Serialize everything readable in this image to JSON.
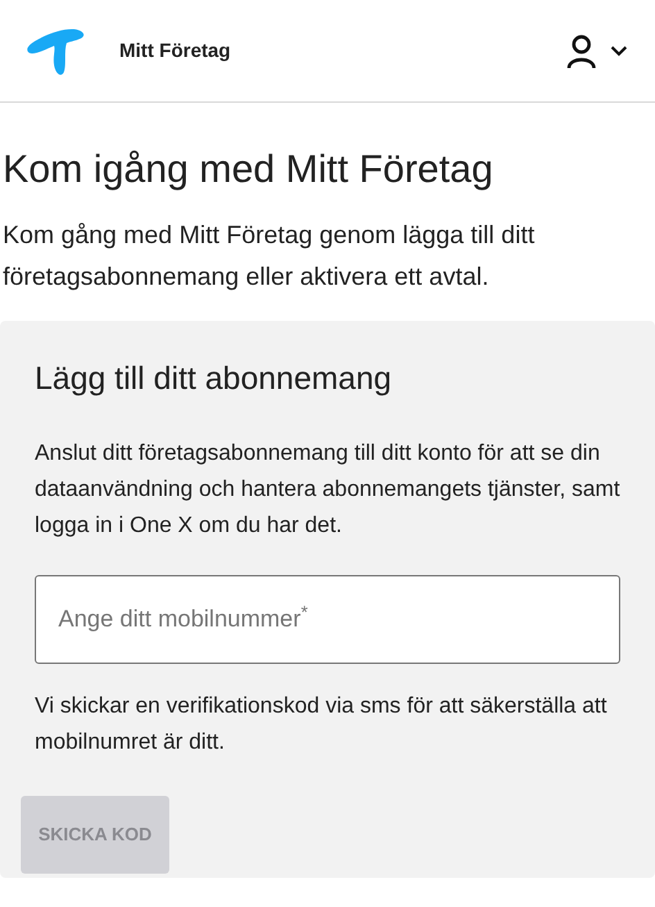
{
  "header": {
    "title": "Mitt Företag"
  },
  "page": {
    "title": "Kom igång med Mitt Företag",
    "intro": "Kom gång med Mitt Företag genom lägga till ditt företagsabonnemang eller aktivera ett avtal."
  },
  "card": {
    "title": "Lägg till ditt abonnemang",
    "description": "Anslut ditt företagsabonnemang till ditt konto för att se din dataanvändning och hantera abonnemangets tjänster, samt logga in i One X om du har det.",
    "phone_field": {
      "placeholder": "Ange ditt mobilnummer$^{*}$"
    },
    "note": "Vi skickar en verifikationskod via sms för att säkerställa att mobilnumret är ditt.",
    "submit": {
      "label": "SKICKA KOD",
      "disabled": true
    }
  }
}
